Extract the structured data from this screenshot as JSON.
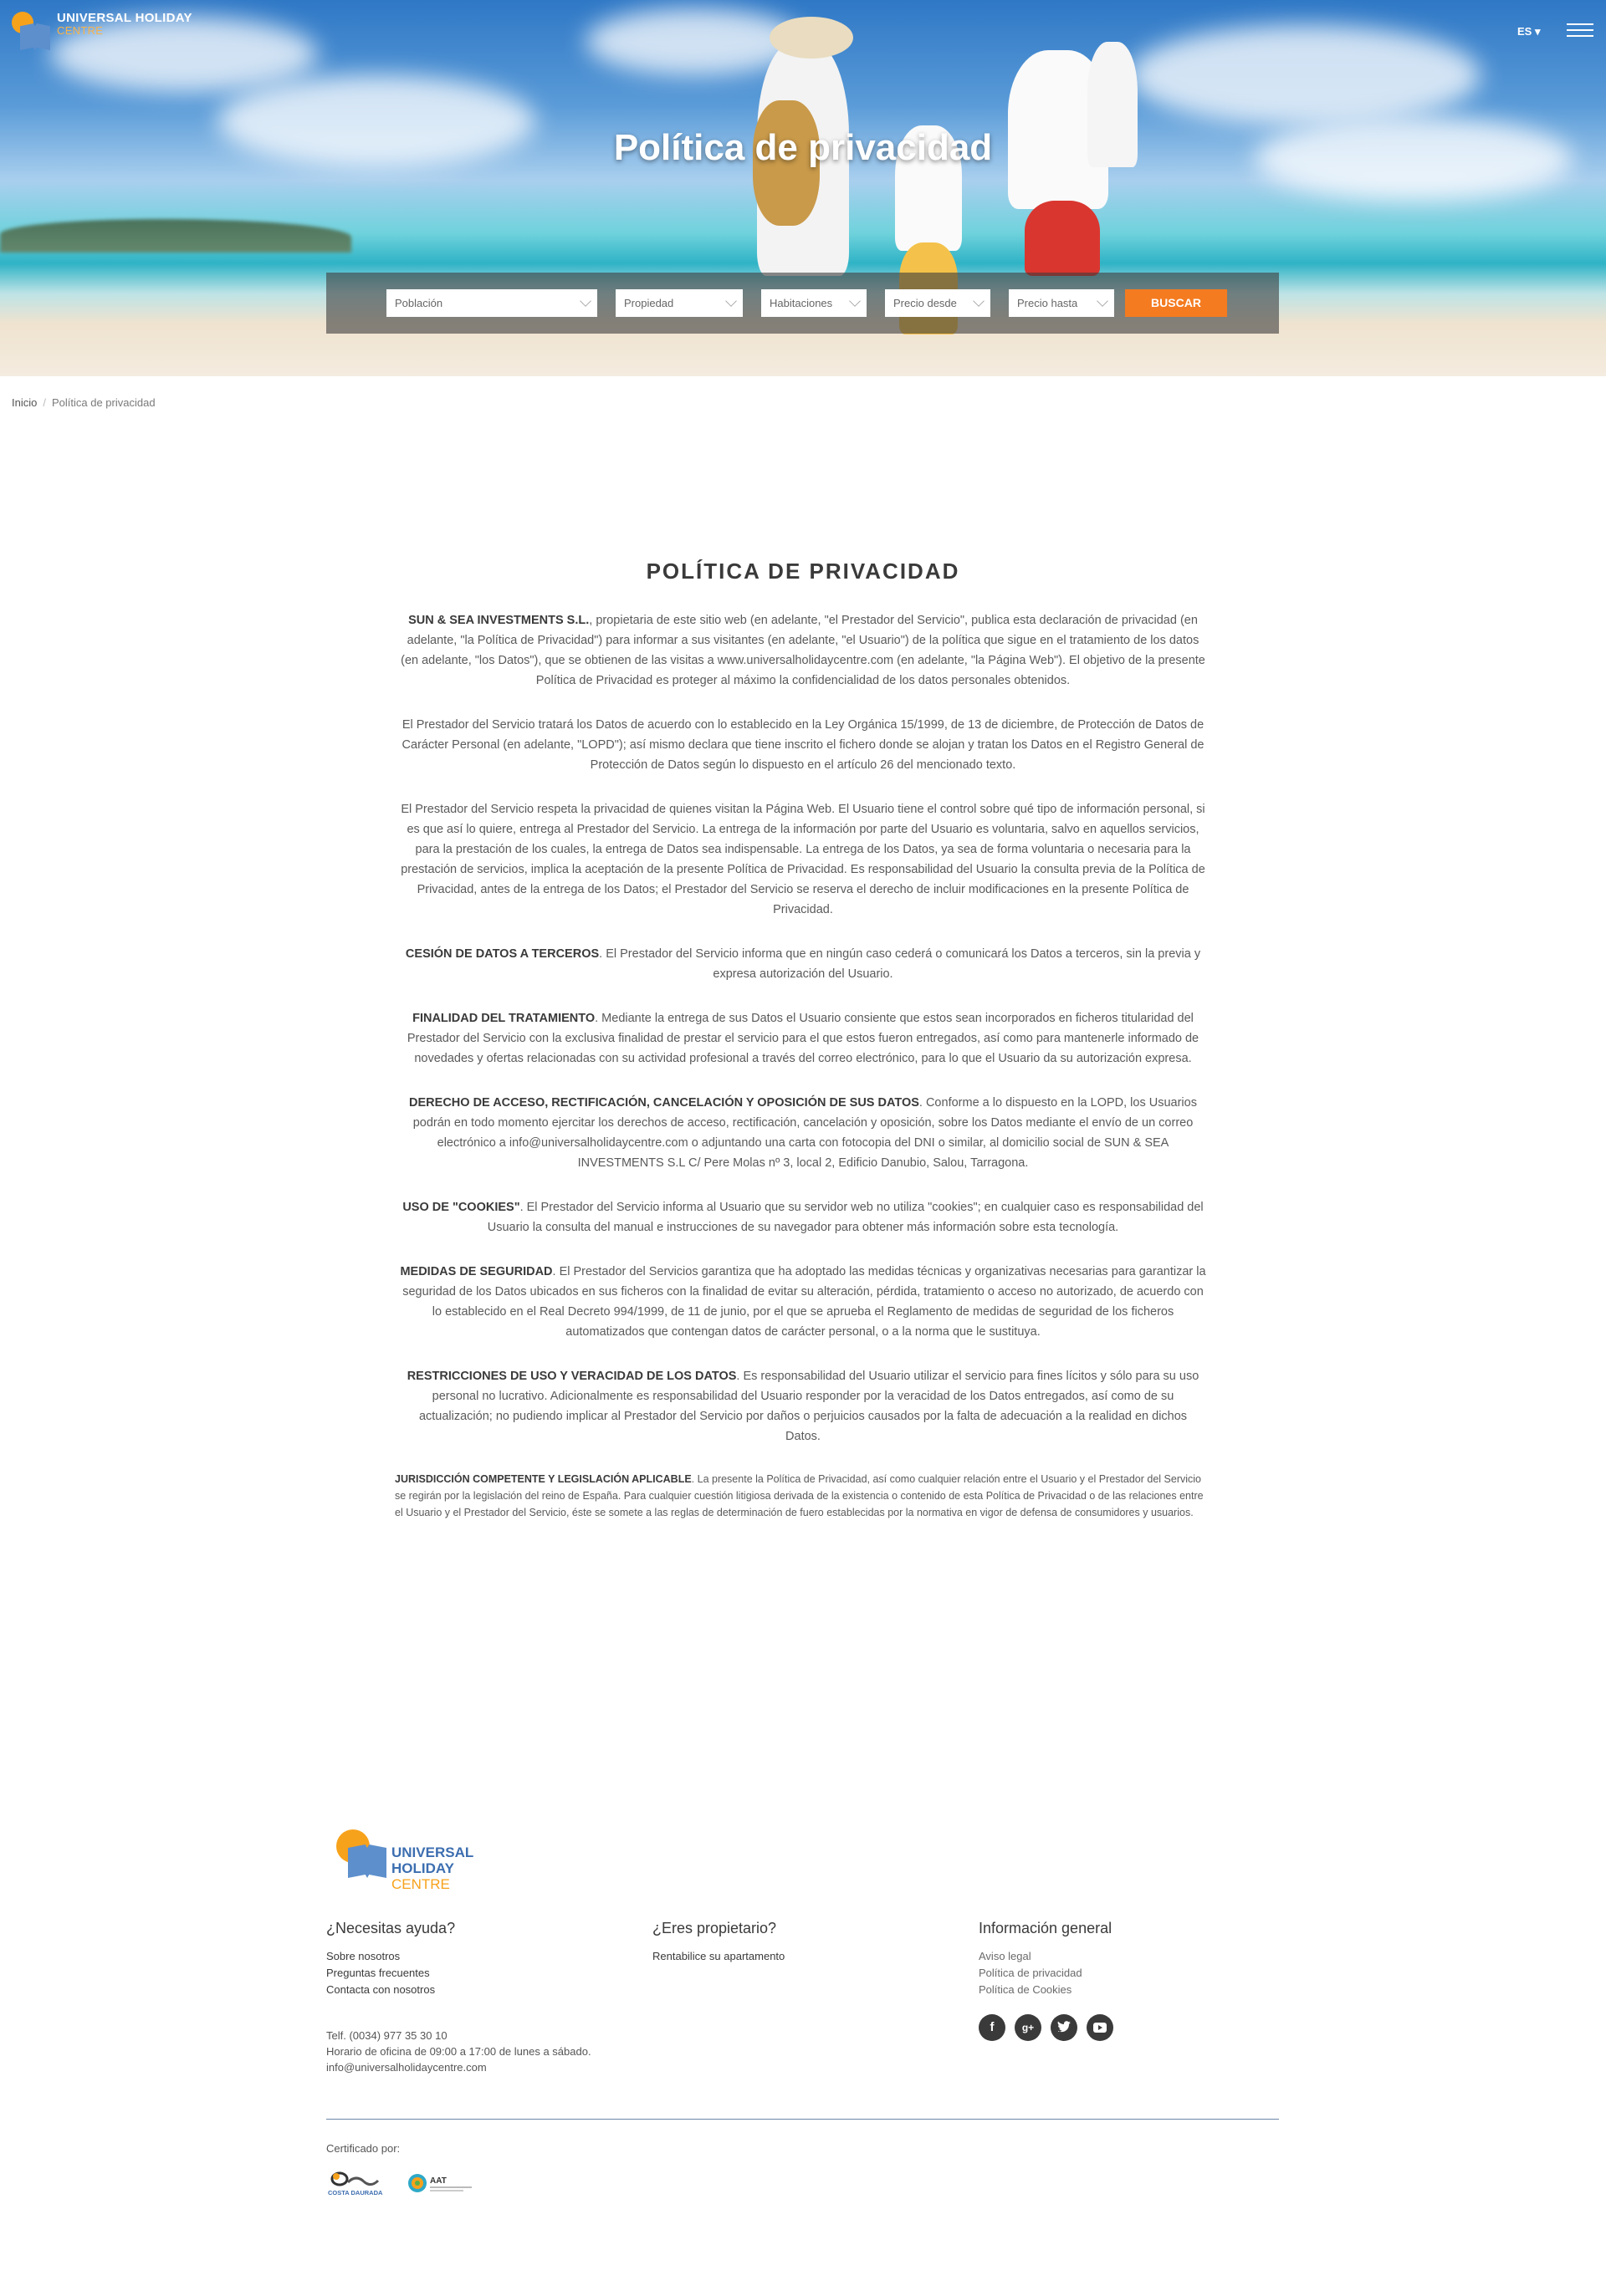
{
  "header": {
    "logo_line1": "UNIVERSAL HOLIDAY",
    "logo_line2": "CENTRE",
    "language": "ES ▾",
    "hero_title": "Política de privacidad"
  },
  "search": {
    "poblacion": "Población",
    "propiedad": "Propiedad",
    "habitaciones": "Habitaciones",
    "precio_desde": "Precio desde",
    "precio_hasta": "Precio hasta",
    "button": "BUSCAR",
    "button_color": "#f47b20"
  },
  "breadcrumb": {
    "home": "Inicio",
    "separator": "/",
    "current": "Política de privacidad"
  },
  "content": {
    "title": "POLÍTICA DE PRIVACIDAD",
    "p1_bold": "SUN & SEA INVESTMENTS S.L.",
    "p1": ", propietaria de este sitio web (en adelante, \"el Prestador del Servicio\", publica esta declaración de privacidad (en adelante, \"la Política de Privacidad\") para informar a sus visitantes (en adelante, \"el Usuario\") de la política que sigue en el tratamiento de los datos (en adelante, \"los Datos\"), que se obtienen de las visitas a www.universalholidaycentre.com (en adelante, \"la Página Web\"). El objetivo de la presente Política de Privacidad es proteger al máximo la confidencialidad de los datos personales obtenidos.",
    "p2": "El Prestador del Servicio tratará los Datos de acuerdo con lo establecido en la Ley Orgánica 15/1999, de 13 de diciembre, de Protección de Datos de Carácter Personal (en adelante, \"LOPD\"); así mismo declara que tiene inscrito el fichero donde se alojan y tratan los Datos en el Registro General de Protección de Datos según lo dispuesto en el artículo 26 del mencionado texto.",
    "p3": "El Prestador del Servicio respeta la privacidad de quienes visitan la Página Web. El Usuario tiene el control sobre qué tipo de información personal, si es que así lo quiere, entrega al Prestador del Servicio. La entrega de la información por parte del Usuario es voluntaria, salvo en aquellos servicios, para la prestación de los cuales, la entrega de Datos sea indispensable. La entrega de los Datos, ya sea de forma voluntaria o necesaria para la prestación de servicios, implica la aceptación de la presente Política de Privacidad. Es responsabilidad del Usuario la consulta previa de la Política de Privacidad, antes de la entrega de los Datos; el Prestador del Servicio se reserva el derecho de incluir modificaciones en la presente Política de Privacidad.",
    "p4_bold": "CESIÓN DE DATOS A TERCEROS",
    "p4": ". El Prestador del Servicio informa que en ningún caso cederá o comunicará los Datos a terceros, sin la previa y expresa autorización del Usuario.",
    "p5_bold": "FINALIDAD DEL TRATAMIENTO",
    "p5": ". Mediante la entrega de sus Datos el Usuario consiente que estos sean incorporados en ficheros titularidad del Prestador del Servicio con la exclusiva finalidad de prestar el servicio para el que estos fueron entregados, así como para mantenerle informado de novedades y ofertas relacionadas con su actividad profesional a través del correo electrónico, para lo que el Usuario da su autorización expresa.",
    "p6_bold": "DERECHO DE ACCESO, RECTIFICACIÓN, CANCELACIÓN Y OPOSICIÓN DE SUS DATOS",
    "p6": ". Conforme a lo dispuesto en la LOPD, los Usuarios podrán en todo momento ejercitar los derechos de acceso, rectificación, cancelación y oposición, sobre los Datos mediante el envío de un correo electrónico a info@universalholidaycentre.com o adjuntando una carta con fotocopia del DNI o similar, al domicilio social de SUN & SEA INVESTMENTS S.L C/ Pere Molas nº 3, local 2, Edificio Danubio, Salou, Tarragona.",
    "p7_bold": "USO DE \"COOKIES\"",
    "p7": ". El Prestador del Servicio informa al Usuario que su servidor web no utiliza \"cookies\"; en cualquier caso es responsabilidad del Usuario la consulta del manual e instrucciones de su navegador para obtener más información sobre esta tecnología.",
    "p8_bold": "MEDIDAS DE SEGURIDAD",
    "p8": ". El Prestador del Servicios garantiza que ha adoptado las medidas técnicas y organizativas necesarias para garantizar la seguridad de los Datos ubicados en sus ficheros con la finalidad de evitar su alteración, pérdida, tratamiento o acceso no autorizado, de acuerdo con lo establecido en el Real Decreto 994/1999, de 11 de junio, por el que se aprueba el Reglamento de medidas de seguridad de los ficheros automatizados que contengan datos de carácter personal, o a la norma que le sustituya.",
    "p9_bold": "RESTRICCIONES DE USO Y VERACIDAD DE LOS DATOS",
    "p9": ". Es responsabilidad del Usuario utilizar el servicio para fines lícitos y sólo para su uso personal no lucrativo. Adicionalmente es responsabilidad del Usuario responder por la veracidad de los Datos entregados, así como de su actualización; no pudiendo implicar al Prestador del Servicio por daños o perjuicios causados por la falta de adecuación a la realidad en dichos Datos.",
    "p10_bold": "JURISDICCIÓN COMPETENTE Y LEGISLACIÓN APLICABLE",
    "p10": ". La presente la Política de Privacidad, así como cualquier relación entre el Usuario y el Prestador del Servicio se regirán por la legislación del reino de España. Para cualquier cuestión litigiosa derivada de la existencia o contenido de esta Política de Privacidad o de las relaciones entre el Usuario y el Prestador del Servicio, éste se somete a las reglas de determinación de fuero establecidas por la normativa en vigor de defensa de consumidores y usuarios."
  },
  "footer": {
    "logo_line1": "UNIVERSAL",
    "logo_line2": "HOLIDAY",
    "logo_line3": "CENTRE",
    "help_title": "¿Necesitas ayuda?",
    "help_links": [
      "Sobre nosotros",
      "Preguntas frecuentes",
      "Contacta con nosotros"
    ],
    "owner_title": "¿Eres propietario?",
    "owner_links": [
      "Rentabilice su apartamento"
    ],
    "info_title": "Información general",
    "info_links": [
      "Aviso legal",
      "Política de privacidad",
      "Política de Cookies"
    ],
    "phone": "Telf. (0034) 977 35 30 10",
    "hours": "Horario de oficina de 09:00 a 17:00 de lunes a sábado.",
    "email": "info@universalholidaycentre.com",
    "social_icons": [
      "facebook-icon",
      "google-plus-icon",
      "twitter-icon",
      "youtube-icon"
    ],
    "certified": "Certificado por:",
    "cert1": "COSTA DAURADA",
    "cert2": "AAT"
  }
}
